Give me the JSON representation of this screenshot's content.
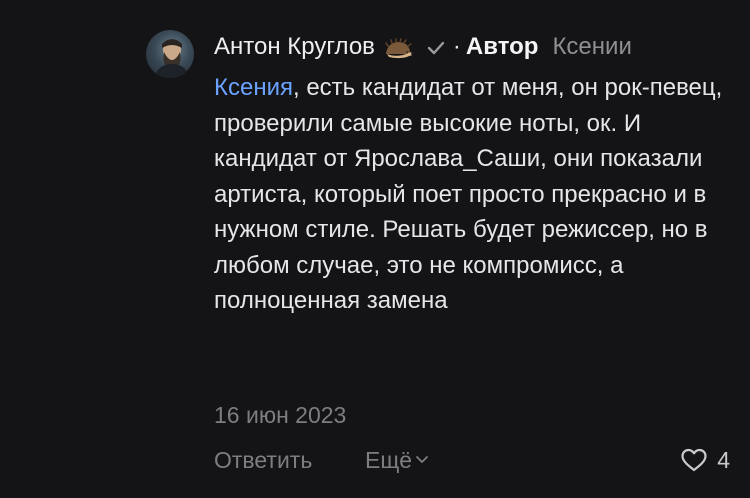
{
  "comment": {
    "author": "Антон Круглов",
    "author_emoji": "hedgehog-icon",
    "verified_icon": "checkmark-icon",
    "dot": "·",
    "badge": "Автор",
    "reply_to": "Ксении",
    "mention": "Ксения",
    "text": ", есть кандидат от меня, он рок-певец, проверили самые высокие ноты, ок. И кандидат от Ярослава_Саши, они показали артиста, который поет просто прекрасно и в нужном стиле. Решать будет режиссер, но в любом случае, это не компромисс, а полноценная замена",
    "date": "16 июн 2023"
  },
  "actions": {
    "reply_label": "Ответить",
    "more_label": "Ещё",
    "more_icon": "chevron-down-icon",
    "like_icon": "heart-icon",
    "like_count": "4"
  },
  "colors": {
    "background": "#141416",
    "text": "#e6e6e8",
    "mention": "#6aa2ff",
    "muted": "#7d7d82"
  }
}
